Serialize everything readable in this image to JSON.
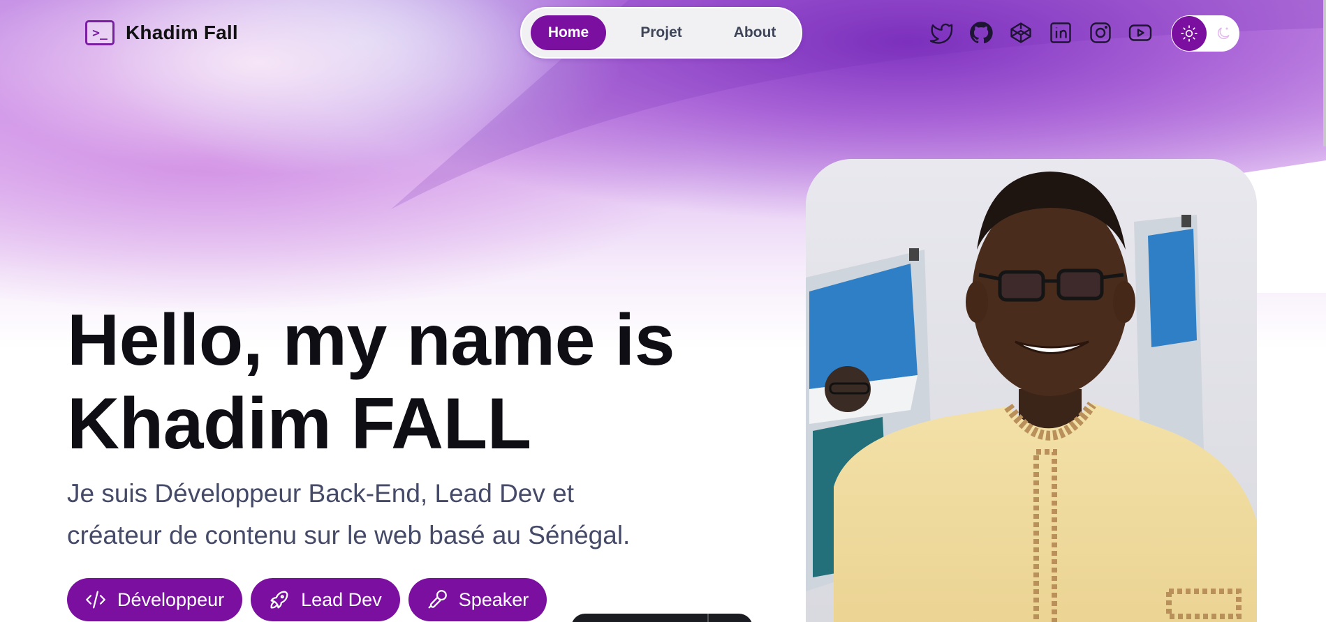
{
  "header": {
    "logo_text": "Khadim Fall",
    "logo_symbol": ">_",
    "nav": [
      {
        "label": "Home",
        "active": true
      },
      {
        "label": "Projet",
        "active": false
      },
      {
        "label": "About",
        "active": false
      }
    ],
    "socials": [
      "twitter-icon",
      "github-icon",
      "codepen-icon",
      "linkedin-icon",
      "instagram-icon",
      "youtube-icon"
    ],
    "theme_toggle": {
      "active": "light",
      "icons": [
        "sun-icon",
        "moon-icon"
      ]
    }
  },
  "hero": {
    "title_line1": "Hello, my name is",
    "title_line2": "Khadim FALL",
    "subtitle_line1": "Je suis Développeur Back-End, Lead Dev et",
    "subtitle_line2": "créateur de contenu sur le web basé au Sénégal.",
    "tags": [
      {
        "label": "Développeur",
        "icon": "code-icon"
      },
      {
        "label": "Lead Dev",
        "icon": "rocket-icon"
      },
      {
        "label": "Speaker",
        "icon": "microphone-icon"
      }
    ]
  },
  "colors": {
    "accent": "#7a0fa0",
    "title": "#0e0e14",
    "subtitle": "#454a68",
    "nav_bg": "#f1f1f3"
  }
}
